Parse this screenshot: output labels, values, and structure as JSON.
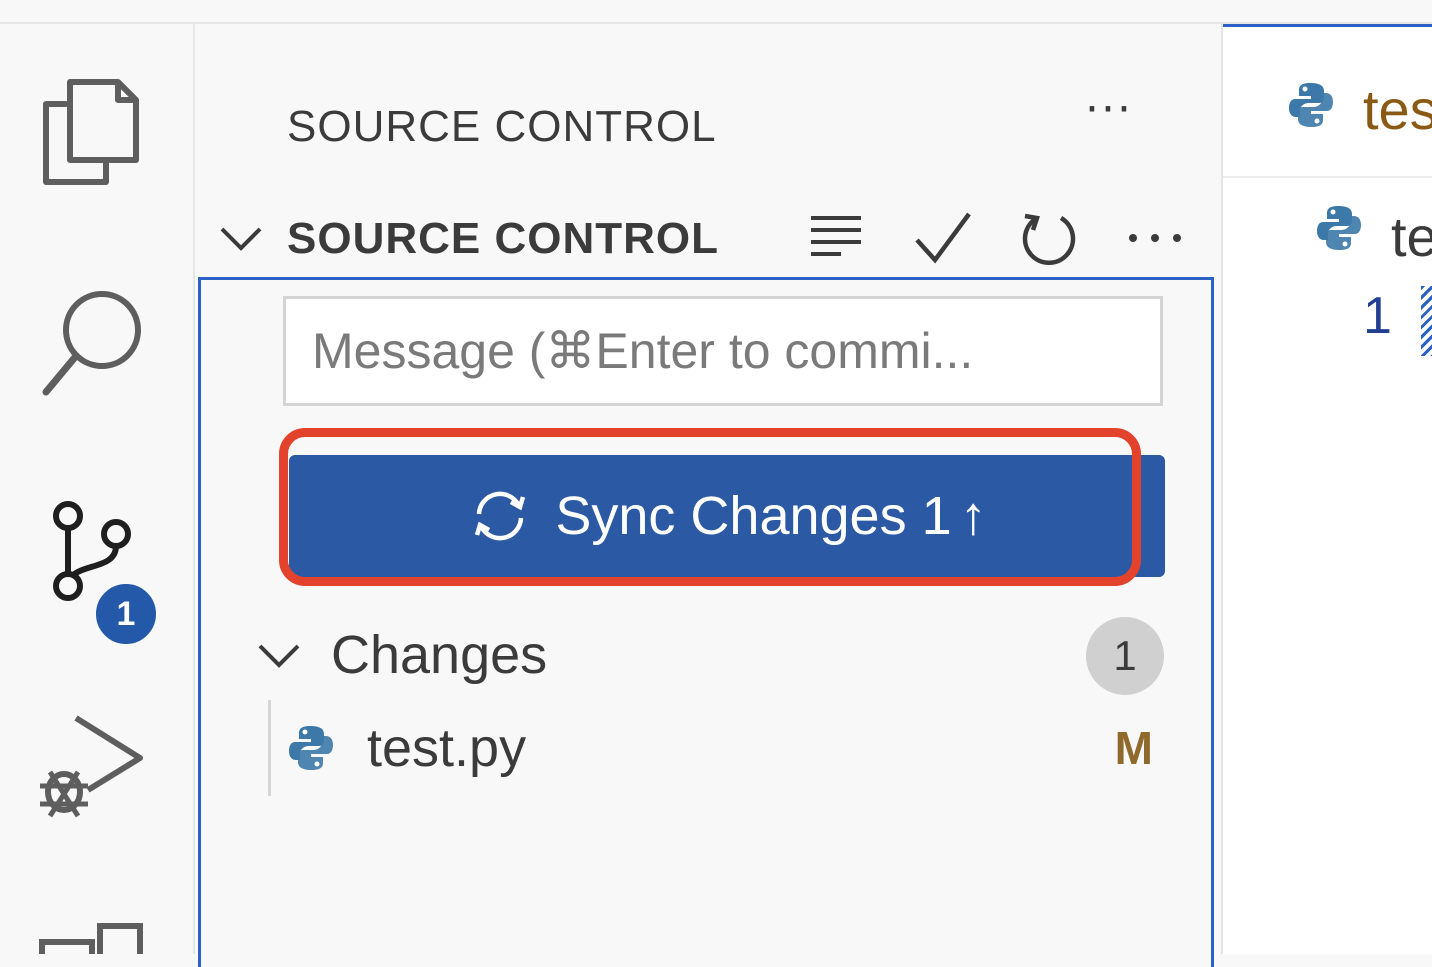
{
  "activity_bar": {
    "items": [
      {
        "name": "explorer",
        "icon": "files-icon"
      },
      {
        "name": "search",
        "icon": "search-icon"
      },
      {
        "name": "source-control",
        "icon": "source-control-icon",
        "badge": "1"
      },
      {
        "name": "run-debug",
        "icon": "run-debug-icon"
      },
      {
        "name": "extensions",
        "icon": "extensions-icon"
      }
    ]
  },
  "sidebar": {
    "title": "SOURCE CONTROL",
    "more_label": "···",
    "section": {
      "title": "SOURCE CONTROL",
      "actions": [
        "list-view-icon",
        "commit-check-icon",
        "refresh-icon",
        "more-icon"
      ],
      "more_label": "···"
    },
    "commit": {
      "placeholder": "Message (⌘Enter to commi..."
    },
    "sync_button": {
      "label": "Sync Changes 1",
      "arrow": "↑",
      "highlighted": true,
      "color": "#2c59a3",
      "highlight_color": "#e3432c"
    },
    "changes": {
      "label": "Changes",
      "count": "1",
      "files": [
        {
          "name": "test.py",
          "status": "M",
          "icon": "python-icon"
        }
      ]
    }
  },
  "editor": {
    "tab_label": "tes",
    "breadcrumb_label": "te",
    "line_number": "1"
  }
}
